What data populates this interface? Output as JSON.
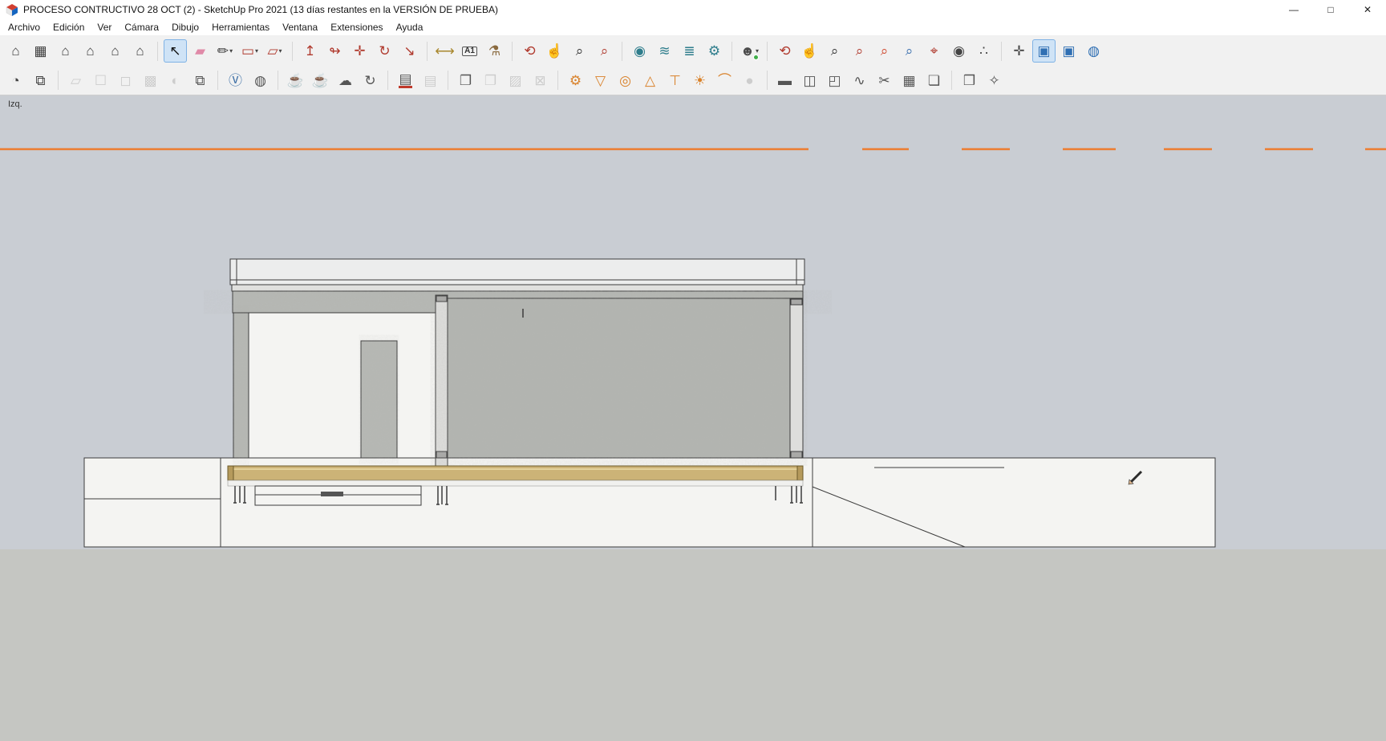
{
  "window": {
    "title": "PROCESO CONTRUCTIVO 28 OCT (2) - SketchUp Pro 2021 (13 días restantes en la VERSIÓN DE PRUEBA)",
    "minimize_glyph": "—",
    "maximize_glyph": "□",
    "close_glyph": "✕"
  },
  "menubar": {
    "items": [
      {
        "id": "archivo",
        "label": "Archivo"
      },
      {
        "id": "edicion",
        "label": "Edición"
      },
      {
        "id": "ver",
        "label": "Ver"
      },
      {
        "id": "camara",
        "label": "Cámara"
      },
      {
        "id": "dibujo",
        "label": "Dibujo"
      },
      {
        "id": "herramientas",
        "label": "Herramientas"
      },
      {
        "id": "ventana",
        "label": "Ventana"
      },
      {
        "id": "extensiones",
        "label": "Extensiones"
      },
      {
        "id": "ayuda",
        "label": "Ayuda"
      }
    ]
  },
  "toolbar_row1": [
    {
      "name": "view-iso",
      "glyph": "⌂",
      "color": "#3d3d3d"
    },
    {
      "name": "view-top",
      "glyph": "▦",
      "color": "#3d3d3d"
    },
    {
      "name": "view-front",
      "glyph": "⌂",
      "color": "#3d3d3d"
    },
    {
      "name": "view-right",
      "glyph": "⌂",
      "color": "#3d3d3d"
    },
    {
      "name": "view-back",
      "glyph": "⌂",
      "color": "#3d3d3d"
    },
    {
      "name": "view-left",
      "glyph": "⌂",
      "color": "#3d3d3d"
    },
    {
      "sep": true
    },
    {
      "name": "select-tool",
      "glyph": "↖",
      "color": "#111111",
      "active": true
    },
    {
      "name": "eraser-tool",
      "glyph": "▰",
      "color": "#e08aa8"
    },
    {
      "name": "line-tool",
      "glyph": "✏",
      "color": "#333333",
      "dropdown": true
    },
    {
      "name": "rectangle-tool",
      "glyph": "▭",
      "color": "#b03a2e",
      "dropdown": true
    },
    {
      "name": "shape-tool",
      "glyph": "▱",
      "color": "#b03a2e",
      "dropdown": true
    },
    {
      "sep": true
    },
    {
      "name": "push-pull-tool",
      "glyph": "↥",
      "color": "#b03a2e"
    },
    {
      "name": "follow-me-tool",
      "glyph": "↬",
      "color": "#b03a2e"
    },
    {
      "name": "move-tool",
      "glyph": "✛",
      "color": "#b03a2e"
    },
    {
      "name": "rotate-tool",
      "glyph": "↻",
      "color": "#b03a2e"
    },
    {
      "name": "scale-tool",
      "glyph": "↘",
      "color": "#b03a2e"
    },
    {
      "sep": true
    },
    {
      "name": "tape-measure-tool",
      "glyph": "⟷",
      "color": "#a8872d"
    },
    {
      "name": "text-tool",
      "glyph": "A1",
      "color": "#333333",
      "text": true
    },
    {
      "name": "paint-bucket-tool",
      "glyph": "⚗",
      "color": "#8a6a3f"
    },
    {
      "sep": true
    },
    {
      "name": "orbit-tool",
      "glyph": "⟲",
      "color": "#b03a2e"
    },
    {
      "name": "pan-tool",
      "glyph": "☝",
      "color": "#c49a5f"
    },
    {
      "name": "zoom-tool",
      "glyph": "⌕",
      "color": "#333333"
    },
    {
      "name": "zoom-window-tool",
      "glyph": "⌕",
      "color": "#b03a2e"
    },
    {
      "sep": true
    },
    {
      "name": "plugin-gear-circle",
      "glyph": "◉",
      "color": "#2e7d8c"
    },
    {
      "name": "plugin-waves",
      "glyph": "≋",
      "color": "#2e7d8c"
    },
    {
      "name": "plugin-layer-waves",
      "glyph": "≣",
      "color": "#2e7d8c"
    },
    {
      "name": "plugin-gears",
      "glyph": "⚙",
      "color": "#2e7d8c"
    },
    {
      "sep": true
    },
    {
      "name": "account",
      "glyph": "☻",
      "color": "#4a4a4a",
      "dropdown": true,
      "badge": "#3fae49"
    },
    {
      "sep": true
    },
    {
      "name": "orbit-tool-2",
      "glyph": "⟲",
      "color": "#b03a2e"
    },
    {
      "name": "pan-tool-2",
      "glyph": "☝",
      "color": "#c49a5f"
    },
    {
      "name": "zoom-tool-2",
      "glyph": "⌕",
      "color": "#333333"
    },
    {
      "name": "zoom-window-tool-2",
      "glyph": "⌕",
      "color": "#b03a2e"
    },
    {
      "name": "zoom-extents-tool",
      "glyph": "⌕",
      "color": "#d0482e"
    },
    {
      "name": "zoom-previous-tool",
      "glyph": "⌕",
      "color": "#3a6fae"
    },
    {
      "name": "position-camera-tool",
      "glyph": "⌖",
      "color": "#b03a2e"
    },
    {
      "name": "look-around-tool",
      "glyph": "◉",
      "color": "#444444"
    },
    {
      "name": "walk-tool",
      "glyph": "∴",
      "color": "#444444"
    },
    {
      "sep": true
    },
    {
      "name": "navigation-cross",
      "glyph": "✛",
      "color": "#444444"
    },
    {
      "name": "view-cube-toggle",
      "glyph": "▣",
      "color": "#2f6fb3",
      "active": true
    },
    {
      "name": "view-cube-alt-toggle",
      "glyph": "▣",
      "color": "#2f6fb3"
    },
    {
      "name": "view-sphere-toggle",
      "glyph": "◍",
      "color": "#2f6fb3"
    }
  ],
  "toolbar_row2": [
    {
      "name": "section-plane-tool",
      "glyph": "◔",
      "color": "#444444"
    },
    {
      "name": "section-display-toggle",
      "glyph": "⧉",
      "color": "#444444"
    },
    {
      "sep": true
    },
    {
      "name": "face-style-xray",
      "glyph": "▱",
      "color": "#9c9c9c",
      "disabled": true
    },
    {
      "name": "face-style-wireframe",
      "glyph": "☐",
      "color": "#9c9c9c",
      "disabled": true
    },
    {
      "name": "face-style-hidden-line",
      "glyph": "◻",
      "color": "#9c9c9c",
      "disabled": true
    },
    {
      "name": "face-style-shaded",
      "glyph": "▩",
      "color": "#9c9c9c",
      "disabled": true
    },
    {
      "name": "face-style-monochrome",
      "glyph": "◐",
      "color": "#9c9c9c",
      "disabled": true
    },
    {
      "name": "paste-in-place",
      "glyph": "⧉",
      "color": "#555555"
    },
    {
      "sep": true
    },
    {
      "name": "vray-asset-editor",
      "glyph": "Ⓥ",
      "color": "#3b6ea5"
    },
    {
      "name": "vray-color-picker",
      "glyph": "◍",
      "color": "#555555"
    },
    {
      "sep": true
    },
    {
      "name": "vray-render",
      "glyph": "☕",
      "color": "#555555"
    },
    {
      "name": "vray-render-interactive",
      "glyph": "☕",
      "color": "#777777"
    },
    {
      "name": "vray-cloud-render",
      "glyph": "☁",
      "color": "#555555"
    },
    {
      "name": "vray-refresh",
      "glyph": "↻",
      "color": "#555555"
    },
    {
      "sep": true
    },
    {
      "name": "vray-frame-buffer",
      "glyph": "▤",
      "color": "#555555",
      "accent": "#c0392b"
    },
    {
      "name": "vray-batch-render",
      "glyph": "▤",
      "color": "#9c9c9c",
      "disabled": true
    },
    {
      "sep": true
    },
    {
      "name": "viewport-render",
      "glyph": "❐",
      "color": "#555555"
    },
    {
      "name": "viewport-render-region",
      "glyph": "❐",
      "color": "#9c9c9c",
      "disabled": true
    },
    {
      "name": "render-image",
      "glyph": "▨",
      "color": "#9c9c9c",
      "disabled": true
    },
    {
      "name": "lock-camera",
      "glyph": "⊠",
      "color": "#9c9c9c",
      "disabled": true
    },
    {
      "sep": true
    },
    {
      "name": "vray-light-gen",
      "glyph": "⚙",
      "color": "#d9822b"
    },
    {
      "name": "vray-spot-light",
      "glyph": "▽",
      "color": "#d9822b"
    },
    {
      "name": "vray-dome-light",
      "glyph": "◎",
      "color": "#d9822b"
    },
    {
      "name": "vray-area-light",
      "glyph": "△",
      "color": "#d9822b"
    },
    {
      "name": "vray-ies-light",
      "glyph": "⊤",
      "color": "#d9822b"
    },
    {
      "name": "vray-omni-light",
      "glyph": "☀",
      "color": "#d9822b"
    },
    {
      "name": "vray-mesh-light",
      "glyph": "⌒",
      "color": "#d9822b"
    },
    {
      "name": "vray-sphere-light",
      "glyph": "●",
      "color": "#9c9c9c",
      "disabled": true
    },
    {
      "sep": true
    },
    {
      "name": "vray-infinite-plane",
      "glyph": "▬",
      "color": "#555555"
    },
    {
      "name": "vray-proxy-export",
      "glyph": "◫",
      "color": "#555555"
    },
    {
      "name": "vray-proxy-import",
      "glyph": "◰",
      "color": "#555555"
    },
    {
      "name": "vray-fur",
      "glyph": "∿",
      "color": "#555555"
    },
    {
      "name": "vray-clipper",
      "glyph": "✂",
      "color": "#555555"
    },
    {
      "name": "vray-displacement",
      "glyph": "▦",
      "color": "#555555"
    },
    {
      "name": "vray-scene-export",
      "glyph": "❏",
      "color": "#555555"
    },
    {
      "sep": true
    },
    {
      "name": "vray-frame-box",
      "glyph": "❒",
      "color": "#555555"
    },
    {
      "name": "vray-toolbox",
      "glyph": "✧",
      "color": "#555555"
    }
  ],
  "viewport": {
    "view_label": "Izq.",
    "colors": {
      "sky": "#c9cdd3",
      "ground": "#c5c6c2",
      "section_plane_orange": "#ed7d31",
      "concrete": "#b5b7b3",
      "wood_beam": "#ccb377",
      "platform_white": "#f4f4f2",
      "edge_stroke": "#3c3c3c"
    }
  }
}
